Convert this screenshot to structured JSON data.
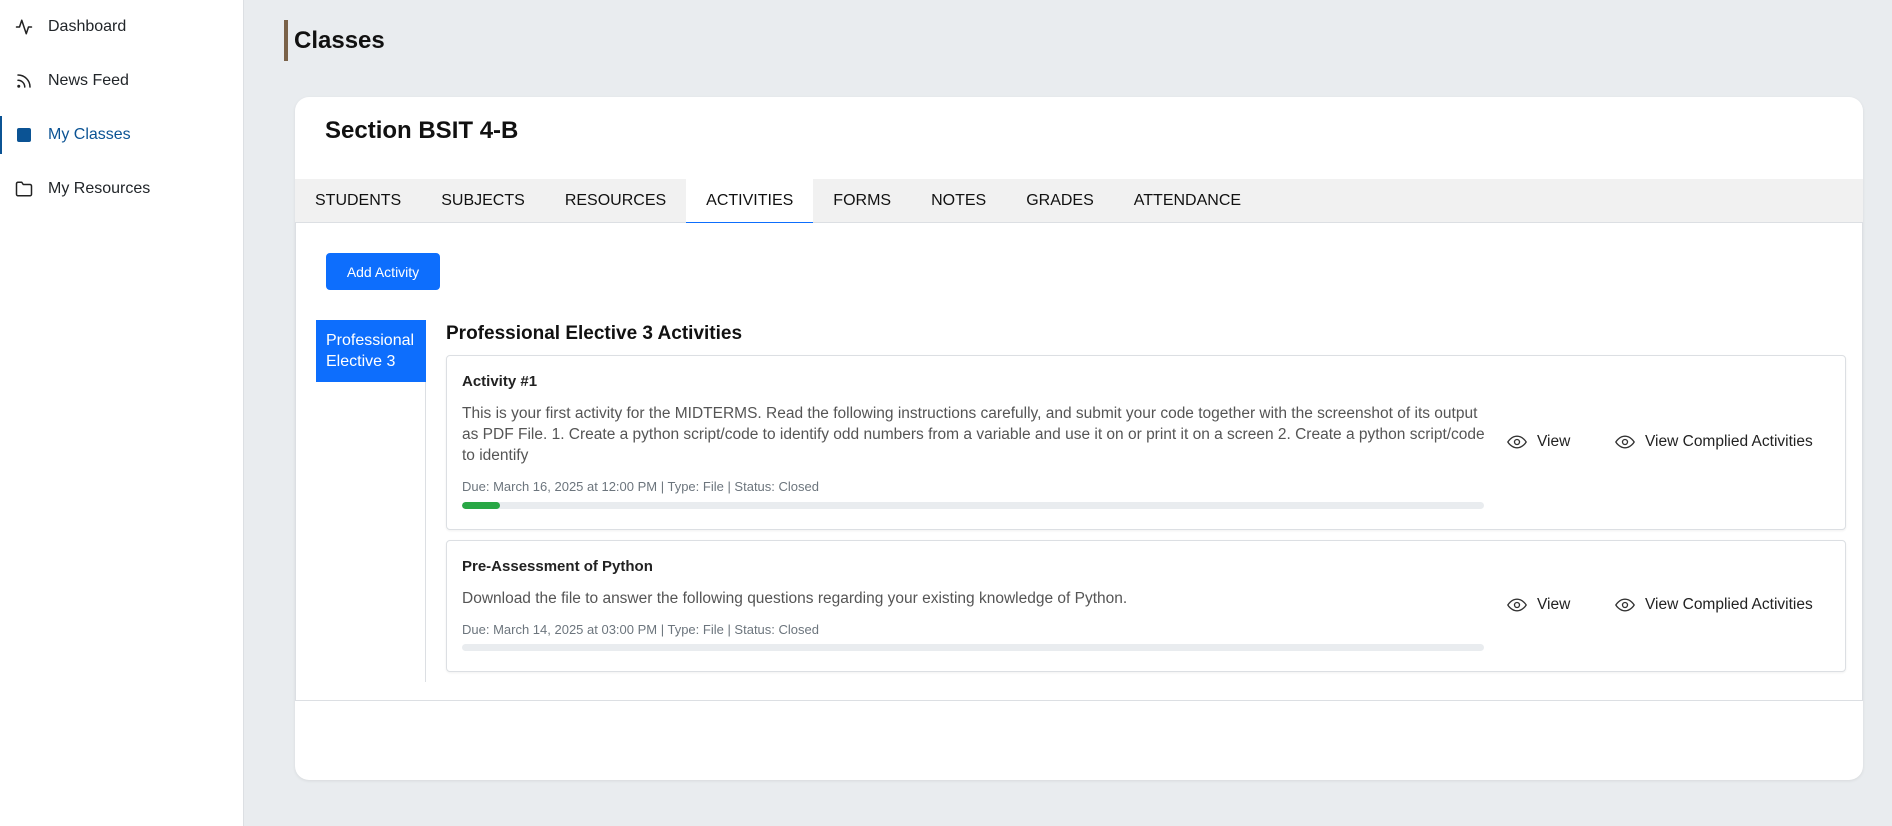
{
  "sidebar": {
    "items": [
      {
        "label": "Dashboard",
        "icon": "activity-icon",
        "active": false
      },
      {
        "label": "News Feed",
        "icon": "rss-icon",
        "active": false
      },
      {
        "label": "My Classes",
        "icon": "square-icon",
        "active": true
      },
      {
        "label": "My Resources",
        "icon": "folder-icon",
        "active": false
      }
    ]
  },
  "header": {
    "title": "Classes"
  },
  "section": {
    "title": "Section BSIT 4-B"
  },
  "tabs": [
    {
      "label": "STUDENTS",
      "active": false
    },
    {
      "label": "SUBJECTS",
      "active": false
    },
    {
      "label": "RESOURCES",
      "active": false
    },
    {
      "label": "ACTIVITIES",
      "active": true
    },
    {
      "label": "FORMS",
      "active": false
    },
    {
      "label": "NOTES",
      "active": false
    },
    {
      "label": "GRADES",
      "active": false
    },
    {
      "label": "ATTENDANCE",
      "active": false
    }
  ],
  "add_activity_label": "Add Activity",
  "subjects": [
    {
      "label": "Professional Elective 3",
      "active": true
    }
  ],
  "activities_heading": "Professional Elective 3 Activities",
  "activities": [
    {
      "title": "Activity #1",
      "description": "This is your first activity for the MIDTERMS. Read the following instructions carefully, and submit your code together with the screenshot of its output as PDF File. 1. Create a python script/code to identify odd numbers from a variable and use it on or print it on a screen 2. Create a python script/code to identify",
      "meta": "Due: March 16, 2025 at 12:00 PM | Type: File | Status: Closed",
      "progress": 0.037,
      "view_label": "View",
      "complied_label": "View Complied Activities"
    },
    {
      "title": "Pre-Assessment of Python",
      "description": "Download the file to answer the following questions regarding your existing knowledge of Python.",
      "meta": "Due: March 14, 2025 at 03:00 PM | Type: File | Status: Closed",
      "progress": 0,
      "view_label": "View",
      "complied_label": "View Complied Activities"
    }
  ],
  "colors": {
    "primary": "#0d6efd",
    "active_nav": "#0b5394",
    "progress": "#28a745",
    "title_accent": "#7a6249",
    "background": "#e9ecef"
  }
}
